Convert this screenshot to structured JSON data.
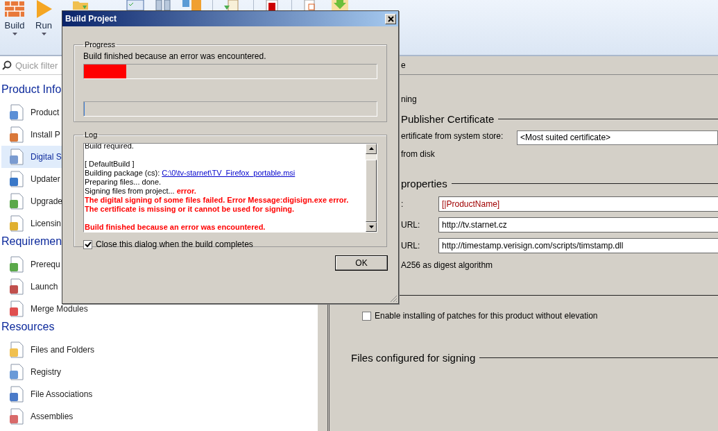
{
  "toolbar": {
    "buttons": [
      {
        "label": "Build",
        "dropdown": true,
        "kind": "build"
      },
      {
        "label": "Run",
        "dropdown": true,
        "kind": "run"
      },
      {
        "kind": "folder"
      }
    ]
  },
  "quick_filter": {
    "placeholder": "Quick filter"
  },
  "sidebar": {
    "sections": [
      {
        "title": "Product Info",
        "items": [
          {
            "label": "Product",
            "selected": false
          },
          {
            "label": "Install P",
            "selected": false
          },
          {
            "label": "Digital S",
            "selected": true
          },
          {
            "label": "Updater",
            "selected": false
          },
          {
            "label": "Upgrade",
            "selected": false
          },
          {
            "label": "Licensin",
            "selected": false
          }
        ]
      },
      {
        "title": "Requiremen",
        "items": [
          {
            "label": "Prerequ",
            "selected": false
          },
          {
            "label": "Launch",
            "selected": false
          },
          {
            "label": "Merge Modules",
            "selected": false
          }
        ]
      },
      {
        "title": "Resources",
        "items": [
          {
            "label": "Files and Folders",
            "selected": false
          },
          {
            "label": "Registry",
            "selected": false
          },
          {
            "label": "File Associations",
            "selected": false
          },
          {
            "label": "Assemblies",
            "selected": false
          }
        ]
      }
    ]
  },
  "main_panel": {
    "header_fragment": "e",
    "signing_fragment": "ning",
    "certificate_section": {
      "title": "Publisher Certificate",
      "store_label": "ertificate from system store:",
      "store_value": "<Most suited certificate>",
      "disk_label": "from disk"
    },
    "properties_section": {
      "title": "properties",
      "fields": [
        {
          "label": ":",
          "value": "[|ProductName]",
          "kind": "reference"
        },
        {
          "label": "URL:",
          "value": "http://tv.starnet.cz",
          "kind": "plain"
        },
        {
          "label": "URL:",
          "value": "http://timestamp.verisign.com/scripts/timstamp.dll",
          "kind": "plain"
        }
      ],
      "digest_label": "A256 as digest algorithm"
    },
    "patch_option": {
      "label": "Enable installing of patches for this product without elevation",
      "checked": false
    },
    "files_section": {
      "title": "Files configured for signing"
    }
  },
  "dialog": {
    "title": "Build Project",
    "progress": {
      "title": "Progress",
      "status": "Build finished because an error was encountered.",
      "bars": [
        {
          "level": 0.145,
          "kind": "error"
        },
        {
          "level": 0,
          "kind": "normal"
        }
      ]
    },
    "log": {
      "title": "Log",
      "lines": [
        {
          "space_before": false,
          "parts": [
            {
              "text": "Build required.",
              "kind": "normal"
            }
          ]
        },
        {
          "space_before": true,
          "parts": [
            {
              "text": "[ DefaultBuild ]",
              "kind": "normal"
            }
          ]
        },
        {
          "space_before": false,
          "parts": [
            {
              "text": "Building package (cs): ",
              "kind": "normal"
            },
            {
              "text": "C:\\0\\tv-starnet\\TV_Firefox_portable.msi",
              "kind": "link"
            }
          ]
        },
        {
          "space_before": false,
          "parts": [
            {
              "text": "Preparing files... done.",
              "kind": "normal"
            }
          ]
        },
        {
          "space_before": false,
          "parts": [
            {
              "text": "Signing files from project... ",
              "kind": "normal"
            },
            {
              "text": "error.",
              "kind": "error"
            }
          ]
        },
        {
          "space_before": false,
          "parts": [
            {
              "text": "The digital signing of some files failed. Error Message:digisign.exe error.",
              "kind": "error"
            }
          ]
        },
        {
          "space_before": false,
          "parts": [
            {
              "text": "The certificate is missing or it cannot be used for signing.",
              "kind": "error"
            }
          ]
        },
        {
          "space_before": true,
          "parts": [
            {
              "text": "Build finished because an error was encountered.",
              "kind": "error"
            }
          ]
        }
      ]
    },
    "close_option": {
      "label": "Close this dialog when the build completes",
      "checked": true
    },
    "ok_button": "OK"
  }
}
